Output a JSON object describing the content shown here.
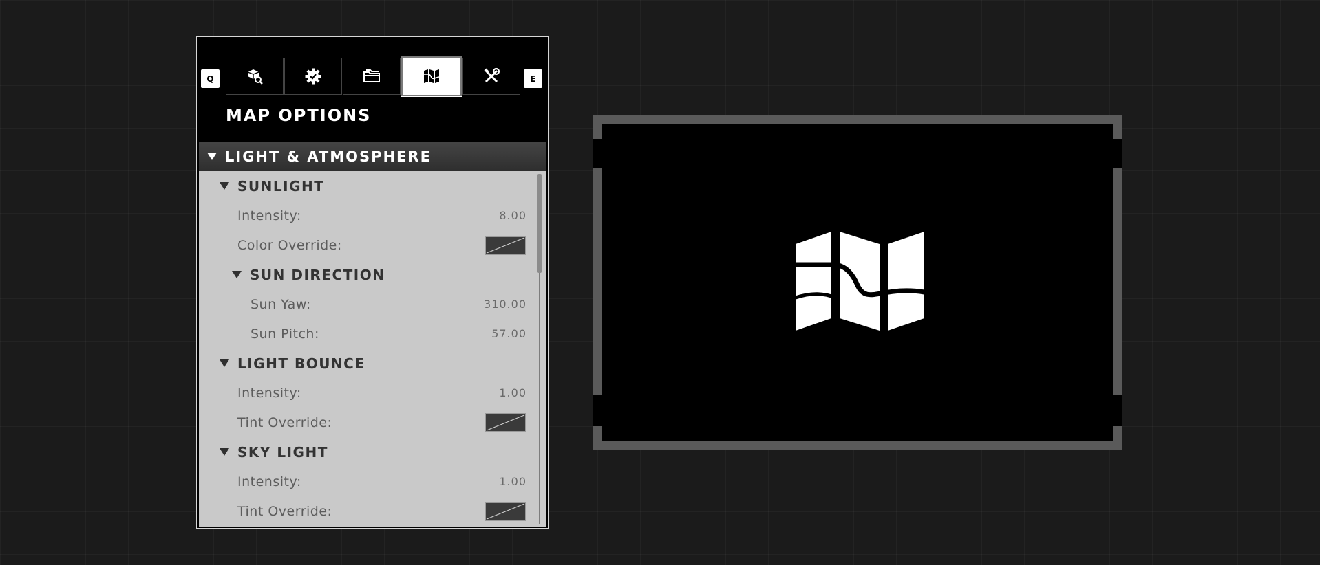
{
  "panel": {
    "left_key": "Q",
    "right_key": "E",
    "tabs": [
      {
        "icon": "object-browser-icon",
        "active": false
      },
      {
        "icon": "gear-icon",
        "active": false
      },
      {
        "icon": "folder-icon",
        "active": false
      },
      {
        "icon": "map-icon",
        "active": true
      },
      {
        "icon": "tools-icon",
        "active": false
      }
    ],
    "title": "MAP OPTIONS",
    "section": "LIGHT & ATMOSPHERE",
    "sunlight": {
      "header": "SUNLIGHT",
      "intensity_label": "Intensity:",
      "intensity_value": "8.00",
      "color_override_label": "Color Override:",
      "sun_direction": {
        "header": "SUN DIRECTION",
        "yaw_label": "Sun Yaw:",
        "yaw_value": "310.00",
        "pitch_label": "Sun Pitch:",
        "pitch_value": "57.00"
      }
    },
    "light_bounce": {
      "header": "LIGHT BOUNCE",
      "intensity_label": "Intensity:",
      "intensity_value": "1.00",
      "tint_override_label": "Tint Override:"
    },
    "sky_light": {
      "header": "SKY LIGHT",
      "intensity_label": "Intensity:",
      "intensity_value": "1.00",
      "tint_override_label": "Tint Override:"
    }
  },
  "preview": {
    "icon": "map-icon"
  },
  "colors": {
    "background": "#1b1b1b",
    "panel_bg": "#000000",
    "content_bg": "#c9c9c9",
    "accent": "#ffffff"
  }
}
